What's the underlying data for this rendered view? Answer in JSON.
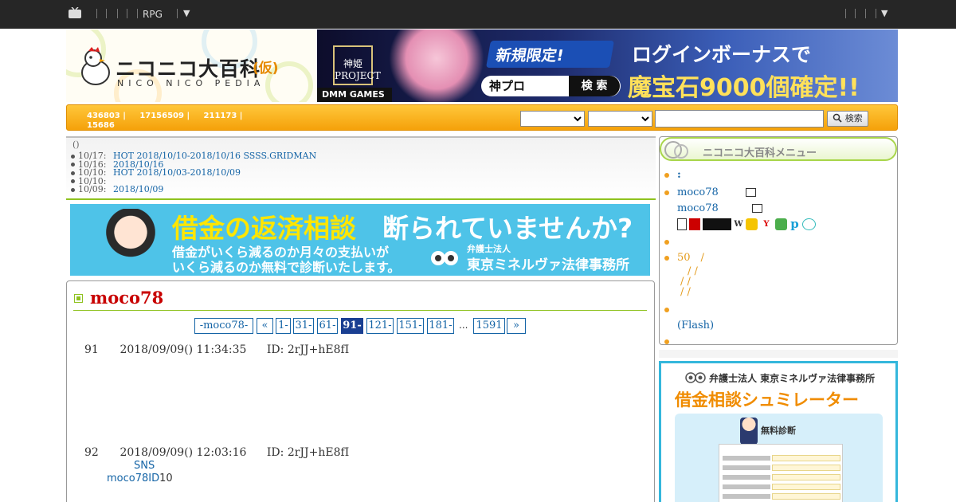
{
  "topbar": {
    "rpg": "RPG",
    "caret": "▼"
  },
  "header": {
    "logo_text": "ニコニコ大百科",
    "logo_tag": "(仮)",
    "logo_sub": "NICO NICO PEDIA",
    "banner": {
      "kamihime": "神姫 PROJECT",
      "new_limited": "新規限定!",
      "login_bonus": "ログインボーナスで",
      "stones": "魔宝石9000個確定!!",
      "search_label": "神プロ",
      "search_button": "検 索",
      "dmm": "DMM GAMES"
    }
  },
  "searchbar": {
    "stat1": "436803 |",
    "stat2": "17156509 |",
    "stat3": "211173 |",
    "stat4": "15686",
    "search_button": "検索"
  },
  "news": {
    "paren": "()",
    "items": [
      {
        "date": "10/17:",
        "link": "HOT 2018/10/10-2018/10/16 SSSS.GRIDMAN"
      },
      {
        "date": "10/16:",
        "link": "2018/10/16"
      },
      {
        "date": "10/10:",
        "link": "HOT 2018/10/03-2018/10/09"
      },
      {
        "date": "10/10:",
        "link": ""
      },
      {
        "date": "10/09:",
        "link": "2018/10/09"
      }
    ]
  },
  "ad_banner": {
    "title1": "借金の返済相談",
    "title2": "断られていませんか?",
    "line1": "借金がいくら減るのか月々の支払いが",
    "line2": "いくら減るのか無料で診断いたします。",
    "law_small": "弁護士法人",
    "law_name": "東京ミネルヴァ法律事務所"
  },
  "article": {
    "title": "moco78",
    "pager": [
      "-moco78-",
      "«",
      "1-",
      "31-",
      "61-",
      "91-",
      "121-",
      "151-",
      "181-",
      "...",
      "1591",
      "»"
    ],
    "responses": [
      {
        "num": "91",
        "date": "2018/09/09() 11:34:35",
        "id": "ID: 2rJJ+hE8fI",
        "body": []
      },
      {
        "num": "92",
        "date": "2018/09/09() 12:03:16",
        "id": "ID: 2rJJ+hE8fI",
        "body": [
          "SNS",
          "moco78ID",
          "10"
        ]
      }
    ]
  },
  "menu": {
    "title": "ニコニコ大百科メニュー",
    "items": {
      "colon": ":",
      "user1": "moco78",
      "user2": "moco78",
      "fifty": "50　/",
      "slashes1": "　/ /",
      "slashes2": "/ /",
      "slashes3": "/ /",
      "flash": "(Flash)"
    },
    "services": [
      "W",
      "Y",
      "p"
    ]
  },
  "side_ad": {
    "law_line": "弁護士法人 東京ミネルヴァ法律事務所",
    "title": "借金相談シュミレーター",
    "free": "無料診断"
  }
}
